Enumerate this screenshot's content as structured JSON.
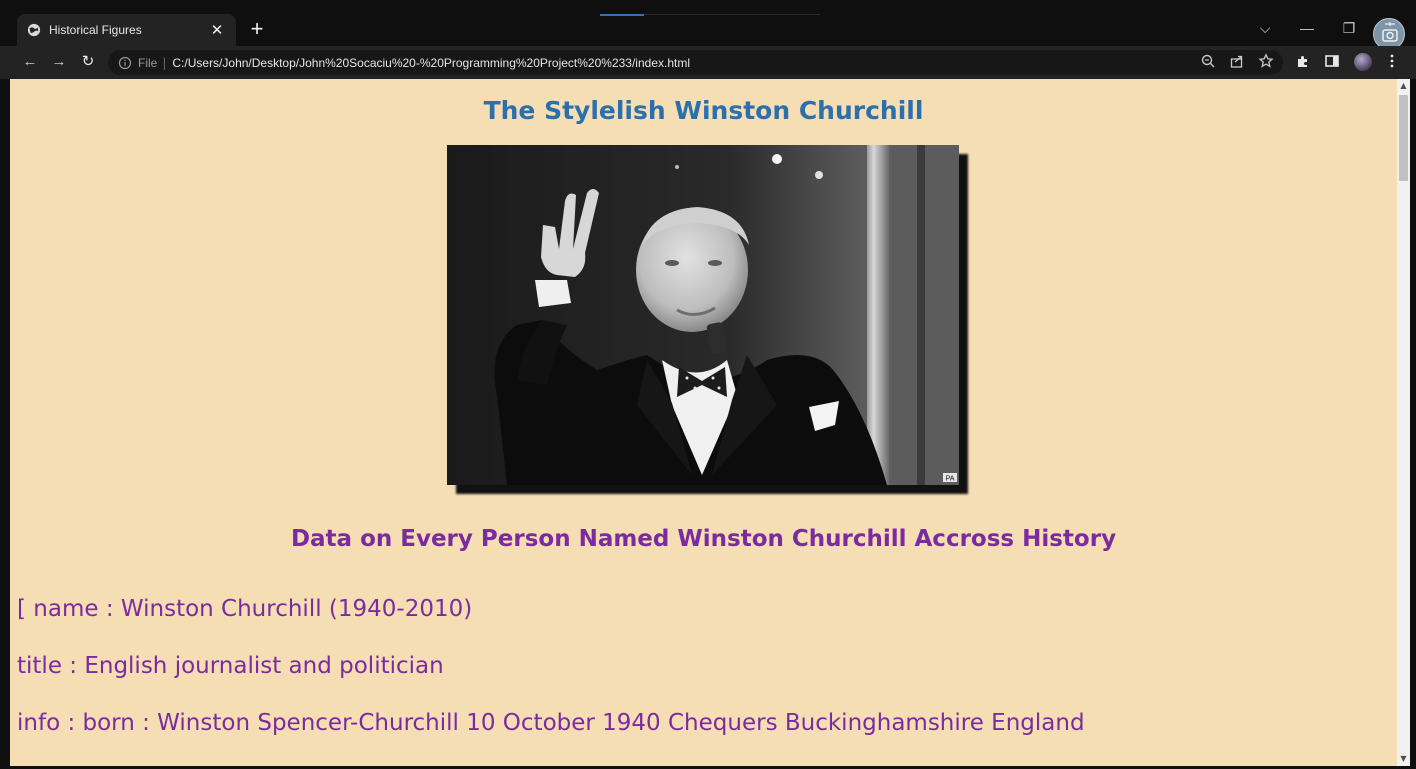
{
  "browser": {
    "tab_title": "Historical Figures",
    "tab_close": "✕",
    "new_tab": "+",
    "file_label": "File",
    "separator": "|",
    "url": "C:/Users/John/Desktop/John%20Socaciu%20-%20Programming%20Project%20%233/index.html",
    "window_controls": {
      "chevron": "⌵",
      "minimize": "—",
      "restore": "❐",
      "close": "✕"
    },
    "nav": {
      "back": "←",
      "forward": "→",
      "reload": "↻"
    }
  },
  "page": {
    "title": "The Stylelish Winston Churchill",
    "subtitle": "Data on Every Person Named Winston Churchill Accross History",
    "lines": [
      "[ name : Winston Churchill (1940-2010)",
      "title : English journalist and politician",
      "info : born : Winston Spencer-Churchill 10 October 1940 Chequers Buckinghamshire England"
    ],
    "photo_watermark": "PA"
  },
  "colors": {
    "page_background": "#f5deb3",
    "title_color": "#2b70ad",
    "text_color": "#7c2aa0"
  }
}
